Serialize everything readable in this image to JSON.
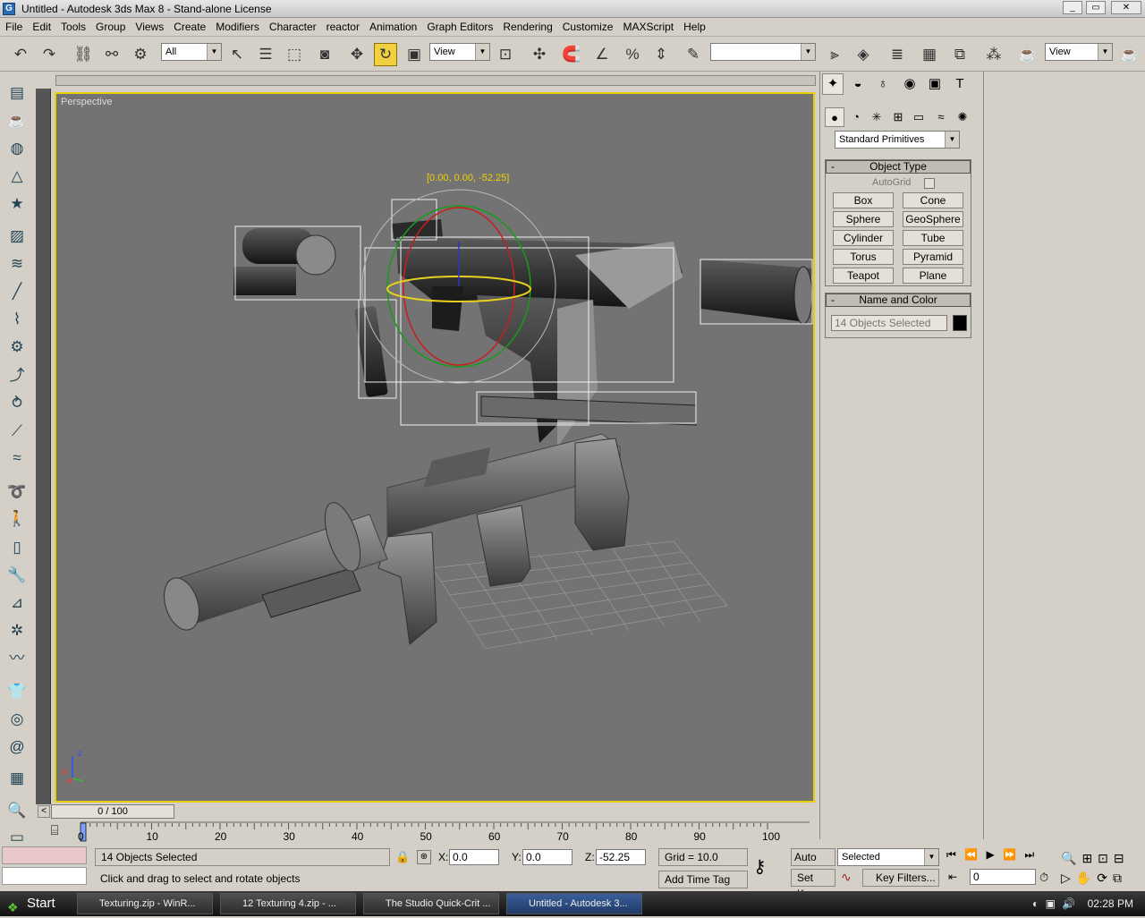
{
  "window": {
    "title": "Untitled - Autodesk 3ds Max 8 - Stand-alone License"
  },
  "menu": [
    "File",
    "Edit",
    "Tools",
    "Group",
    "Views",
    "Create",
    "Modifiers",
    "Character",
    "reactor",
    "Animation",
    "Graph Editors",
    "Rendering",
    "Customize",
    "MAXScript",
    "Help"
  ],
  "toolbar": {
    "selection_filter": "All",
    "ref_coord": "View",
    "named_selection": "",
    "render_view": "View"
  },
  "viewport": {
    "label": "Perspective",
    "transform_readout": "[0.00, 0.00, -52.25]",
    "axis_z": "z",
    "axis_x": "x"
  },
  "timeline": {
    "slider": "0 / 100",
    "ticks": [
      "0",
      "10",
      "20",
      "30",
      "40",
      "50",
      "60",
      "70",
      "80",
      "90",
      "100"
    ]
  },
  "command_panel": {
    "category": "Standard Primitives",
    "object_type_title": "Object Type",
    "autogrid_label": "AutoGrid",
    "buttons": [
      "Box",
      "Cone",
      "Sphere",
      "GeoSphere",
      "Cylinder",
      "Tube",
      "Torus",
      "Pyramid",
      "Teapot",
      "Plane"
    ],
    "name_color_title": "Name and Color",
    "name_value": "14 Objects Selected",
    "color": "#000000"
  },
  "status": {
    "selection": "14 Objects Selected",
    "prompt": "Click and drag to select and rotate objects",
    "x_label": "X:",
    "x": "0.0",
    "y_label": "Y:",
    "y": "0.0",
    "z_label": "Z:",
    "z": "-52.25",
    "grid": "Grid = 10.0",
    "add_time_tag": "Add Time Tag",
    "auto_key": "Auto Key",
    "set_key": "Set Key",
    "key_mode": "Selected",
    "key_filters": "Key Filters...",
    "frame": "0"
  },
  "taskbar": {
    "start": "Start",
    "tasks": [
      "Texturing.zip - WinR...",
      "12 Texturing 4.zip - ...",
      "The Studio Quick-Crit ...",
      "Untitled - Autodesk 3..."
    ],
    "clock": "02:28 PM"
  }
}
